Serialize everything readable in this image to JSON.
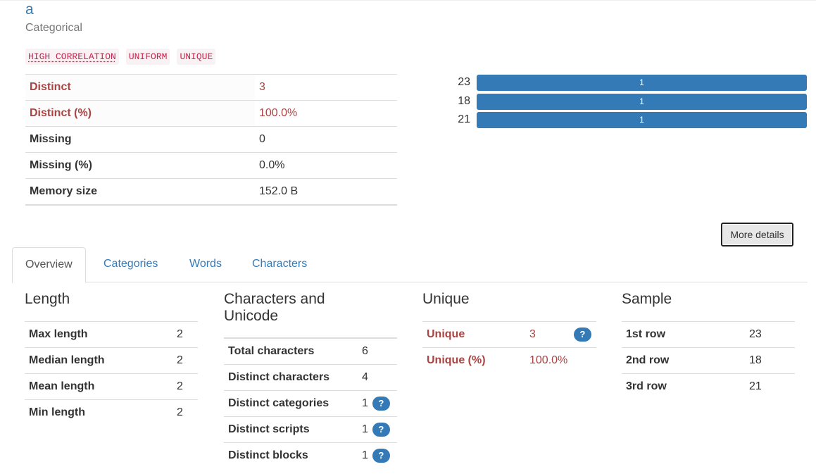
{
  "variable": {
    "name": "a",
    "type": "Categorical"
  },
  "badges": [
    "HIGH CORRELATION",
    "UNIFORM",
    "UNIQUE"
  ],
  "stats": [
    {
      "label": "Distinct",
      "value": "3",
      "alert": true
    },
    {
      "label": "Distinct (%)",
      "value": "100.0%",
      "alert": true
    },
    {
      "label": "Missing",
      "value": "0",
      "alert": false
    },
    {
      "label": "Missing (%)",
      "value": "0.0%",
      "alert": false
    },
    {
      "label": "Memory size",
      "value": "152.0 B",
      "alert": false
    }
  ],
  "frequencies": [
    {
      "label": "23",
      "count": "1",
      "fraction": 1.0
    },
    {
      "label": "18",
      "count": "1",
      "fraction": 1.0
    },
    {
      "label": "21",
      "count": "1",
      "fraction": 1.0
    }
  ],
  "more_details_label": "More details",
  "tabs": [
    "Overview",
    "Categories",
    "Words",
    "Characters"
  ],
  "active_tab": "Overview",
  "length": {
    "title": "Length",
    "rows": [
      {
        "label": "Max length",
        "value": "2"
      },
      {
        "label": "Median length",
        "value": "2"
      },
      {
        "label": "Mean length",
        "value": "2"
      },
      {
        "label": "Min length",
        "value": "2"
      }
    ]
  },
  "characters": {
    "title": "Characters and Unicode",
    "rows": [
      {
        "label": "Total characters",
        "value": "6",
        "help": false
      },
      {
        "label": "Distinct characters",
        "value": "4",
        "help": false
      },
      {
        "label": "Distinct categories",
        "value": "1",
        "help": true
      },
      {
        "label": "Distinct scripts",
        "value": "1",
        "help": true
      },
      {
        "label": "Distinct blocks",
        "value": "1",
        "help": true
      }
    ]
  },
  "unique": {
    "title": "Unique",
    "rows": [
      {
        "label": "Unique",
        "value": "3",
        "help": true
      },
      {
        "label": "Unique (%)",
        "value": "100.0%",
        "help": false
      }
    ]
  },
  "sample": {
    "title": "Sample",
    "rows": [
      {
        "label": "1st row",
        "value": "23"
      },
      {
        "label": "2nd row",
        "value": "18"
      },
      {
        "label": "3rd row",
        "value": "21"
      }
    ]
  },
  "help_glyph": "?",
  "colors": {
    "accent": "#337ab7",
    "alert": "#a94442",
    "badge_text": "#c7254e",
    "badge_bg": "#f9f2f4"
  }
}
